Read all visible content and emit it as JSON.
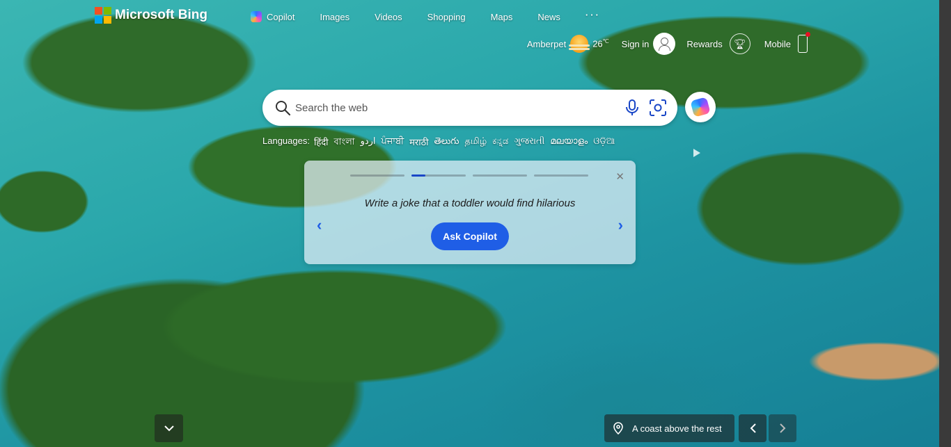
{
  "brand": {
    "name": "Microsoft Bing",
    "colors": [
      "#f25022",
      "#7fba00",
      "#00a4ef",
      "#ffb900"
    ]
  },
  "nav": {
    "items": [
      {
        "label": "Copilot",
        "icon": "copilot-icon"
      },
      {
        "label": "Images"
      },
      {
        "label": "Videos"
      },
      {
        "label": "Shopping"
      },
      {
        "label": "Maps"
      },
      {
        "label": "News"
      }
    ],
    "more": "···"
  },
  "header": {
    "location": "Amberpet",
    "temperature": "26",
    "temp_unit": "℃",
    "signin_label": "Sign in",
    "rewards_label": "Rewards",
    "mobile_label": "Mobile"
  },
  "search": {
    "placeholder": "Search the web"
  },
  "languages": {
    "label": "Languages:",
    "items": [
      "हिंदी",
      "বাংলা",
      "اردو",
      "ਪੰਜਾਬੀ",
      "मराठी",
      "తెలుగు",
      "தமிழ்",
      "ಕನ್ನಡ",
      "ગુજરાતી",
      "മലയാളം",
      "ଓଡ଼ିଆ"
    ]
  },
  "copilot_card": {
    "prompt": "Write a joke that a toddler would find hilarious",
    "button_label": "Ask Copilot",
    "close_label": "✕",
    "slide_count": 4,
    "active_slide": 2,
    "accent": "#1f5ee6"
  },
  "image_caption": {
    "label": "A coast above the rest"
  }
}
